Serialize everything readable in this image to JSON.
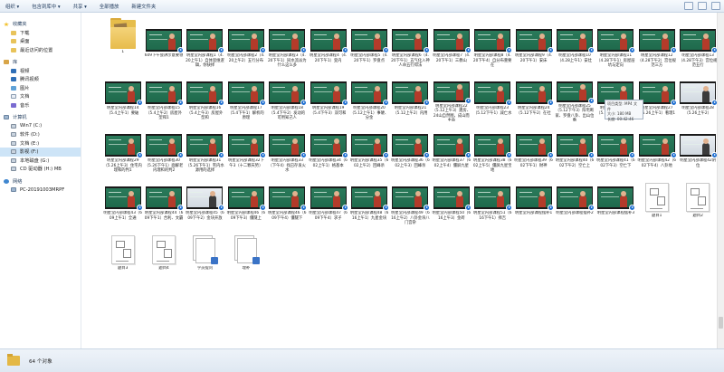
{
  "toolbar": {
    "items": [
      {
        "label": "组织 ▾"
      },
      {
        "label": "包含到库中 ▾"
      },
      {
        "label": "共享 ▾"
      },
      {
        "label": "全部播放"
      },
      {
        "label": "新建文件夹"
      }
    ]
  },
  "nav": {
    "items": [
      {
        "label": "收藏夹",
        "icon": "star-icon",
        "group": true
      },
      {
        "label": "下载",
        "icon": "folder-icon"
      },
      {
        "label": "桌面",
        "icon": "folder-icon"
      },
      {
        "label": "最近访问的位置",
        "icon": "folder-icon"
      },
      {
        "label": "库",
        "icon": "library-icon",
        "group": true
      },
      {
        "label": "视频",
        "icon": "video-icon"
      },
      {
        "label": "腾讯视频",
        "icon": "video-icon"
      },
      {
        "label": "图片",
        "icon": "image-icon"
      },
      {
        "label": "文档",
        "icon": "document-icon"
      },
      {
        "label": "音乐",
        "icon": "music-icon"
      },
      {
        "label": "计算机",
        "icon": "computer-icon",
        "group": true
      },
      {
        "label": "Win7 (C:)",
        "icon": "drive-icon"
      },
      {
        "label": "软件 (D:)",
        "icon": "drive-icon"
      },
      {
        "label": "文档 (E:)",
        "icon": "drive-icon"
      },
      {
        "label": "影视 (F:)",
        "icon": "drive-icon",
        "selected": true
      },
      {
        "label": "本地磁盘 (G:)",
        "icon": "drive-icon"
      },
      {
        "label": "CD 驱动器 (H:) MB",
        "icon": "drive-icon"
      },
      {
        "label": "网络",
        "icon": "network-icon",
        "group": true
      },
      {
        "label": "PC-20191003MRPF",
        "icon": "computer-icon"
      }
    ]
  },
  "files": [
    {
      "label": "1",
      "kind": "folder"
    },
    {
      "label": "609下午会讲示意要领",
      "kind": "video"
    },
    {
      "label": "明星堂内部课程1（4.20上午1）自体思维逻辑，你抉择",
      "kind": "video"
    },
    {
      "label": "明星堂内部课程2（4.20上午2）五行分布",
      "kind": "video"
    },
    {
      "label": "明星堂内部课程3（4.20下午1）同水流派为什么这么多",
      "kind": "video"
    },
    {
      "label": "明星堂内部课程4（4.20下午1）变内",
      "kind": "video"
    },
    {
      "label": "明星堂内部课程5（4.20下午1）罗盘点",
      "kind": "video"
    },
    {
      "label": "明星堂内部课程6（4.20下午1）五气化入神人命五行得法",
      "kind": "video"
    },
    {
      "label": "明星堂内部课程7（4.20下午1）三教山",
      "kind": "video"
    },
    {
      "label": "明星堂内部课程8（4.20下午4）自分布重要在",
      "kind": "video"
    },
    {
      "label": "明星堂内部课程9（4.20下午1）安床",
      "kind": "video"
    },
    {
      "label": "明星堂内部课程10（4.28上午1）安灶",
      "kind": "video"
    },
    {
      "label": "明星堂内部课程11（4.28下午1）房屋层坑与定向",
      "kind": "video"
    },
    {
      "label": "明星堂内部课程12（4.28下午2）宫位规范三方",
      "kind": "video"
    },
    {
      "label": "明星堂内部课程13（4.28下午3）宫位规范五行",
      "kind": "video"
    },
    {
      "label": "明星堂内部课程14（5.4上午1）要破",
      "kind": "video"
    },
    {
      "label": "明星堂内部课程15（5.4上午2）房屋外型和1",
      "kind": "video"
    },
    {
      "label": "明星堂内部课程16（5.4上午3）房屋外型和",
      "kind": "video"
    },
    {
      "label": "明星堂内部课程17（5.4下午1）解析的原理",
      "kind": "video"
    },
    {
      "label": "明星堂内部课程18（5.4下午2）发动的可用知己人",
      "kind": "video"
    },
    {
      "label": "明星堂内部课程19（5.4下午3）双可和",
      "kind": "video"
    },
    {
      "label": "明星堂内部课程20（5.12上午1）事硬、分金",
      "kind": "video"
    },
    {
      "label": "明星堂内部课程21（5.12上午2）内用",
      "kind": "video"
    },
    {
      "label": "明星堂内部课程22（5.12上午3）建房、24山自然图，成山而主命",
      "kind": "video"
    },
    {
      "label": "明星堂内部课程23（5.12下午1）减亡水",
      "kind": "video"
    },
    {
      "label": "明星堂内部课程24（5.12下午2）在社",
      "kind": "video"
    },
    {
      "label": "明星堂内部课程25（5.12下午3）阳宅断家、罗盘八卦、出山位数",
      "kind": "video"
    },
    {
      "label": "明星堂内部课程26（5.12下午4）内硬内",
      "kind": "video"
    },
    {
      "label": "明星堂内部课程27（5.26上午1）看理1",
      "kind": "video"
    },
    {
      "label": "明星堂内部课程28（5.26上午2）",
      "kind": "video",
      "thumb": "light"
    },
    {
      "label": "明星堂内部课程29（5.26上午3）住宅内理和的判1",
      "kind": "video"
    },
    {
      "label": "明星堂内部课程30（5.26下午1）面解老内理和的判2",
      "kind": "video"
    },
    {
      "label": "明星堂内部课程31（5.26下午1）宅内水源用的选择",
      "kind": "video"
    },
    {
      "label": "明星堂内部课程32下午3（十二颗天势）",
      "kind": "video"
    },
    {
      "label": "明星堂内部课程33（下午4）找已存发火水",
      "kind": "video"
    },
    {
      "label": "明星堂内部课程34（602上午1）格基本",
      "kind": "video"
    },
    {
      "label": "明星堂内部课程35（602上午2）回峰杀",
      "kind": "video"
    },
    {
      "label": "明星堂内部课程36（602上午3）回峰杀",
      "kind": "video"
    },
    {
      "label": "明星堂内部课程37（602上午4）僵屏九星",
      "kind": "video"
    },
    {
      "label": "明星堂内部课程38（602上午5）僵屏九星宝地",
      "kind": "video"
    },
    {
      "label": "明星堂内部课程39（602下午1）财神",
      "kind": "video"
    },
    {
      "label": "明星堂内部课程40（602下午2）空亡上",
      "kind": "video"
    },
    {
      "label": "明星堂内部课程41（602下午3）空亡下",
      "kind": "video"
    },
    {
      "label": "明星堂内部课程42（602下午4）八卦地",
      "kind": "video"
    },
    {
      "label": "明星堂内部课程42阴位",
      "kind": "video",
      "thumb": "light"
    },
    {
      "label": "明星堂内部课程43（609上午1）全通",
      "kind": "video"
    },
    {
      "label": "明星堂内部课程44（609下午1）合利、文霸",
      "kind": "video"
    },
    {
      "label": "明星堂内部课程45（609下午2）金块开放",
      "kind": "video",
      "thumb": "light"
    },
    {
      "label": "明星堂内部课程46（609下午3）僵隧上",
      "kind": "video"
    },
    {
      "label": "明星堂内部课程46（609下午4）僵隧下",
      "kind": "video"
    },
    {
      "label": "明星堂内部课程47（609下午4）求子",
      "kind": "video"
    },
    {
      "label": "明星堂内部课程48（616上午1）九星金块",
      "kind": "video"
    },
    {
      "label": "明星堂内部课程49（616上午2）八卦金块八门宫杂",
      "kind": "video"
    },
    {
      "label": "明星堂内部课程50（616上午3）金砖",
      "kind": "video"
    },
    {
      "label": "明星堂内部课程51（616下午1）择吉",
      "kind": "video"
    },
    {
      "label": "明星堂内部课程摆补1",
      "kind": "video"
    },
    {
      "label": "明星堂内部课程摆补2",
      "kind": "video"
    },
    {
      "label": "明星堂内部课程摆补3",
      "kind": "video"
    },
    {
      "label": "题目1",
      "kind": "diagram"
    },
    {
      "label": "题目2",
      "kind": "diagram"
    },
    {
      "label": "题目3",
      "kind": "diagram"
    },
    {
      "label": "题目4",
      "kind": "diagram"
    },
    {
      "label": "学员提问",
      "kind": "stack"
    },
    {
      "label": "理补",
      "kind": "stack"
    }
  ],
  "tooltip": {
    "line1": "项目类型: MP4 文件",
    "line2": "大小: 180 MB",
    "line3": "长度: 00:42:46"
  },
  "status": {
    "count_text": "64 个对象"
  }
}
